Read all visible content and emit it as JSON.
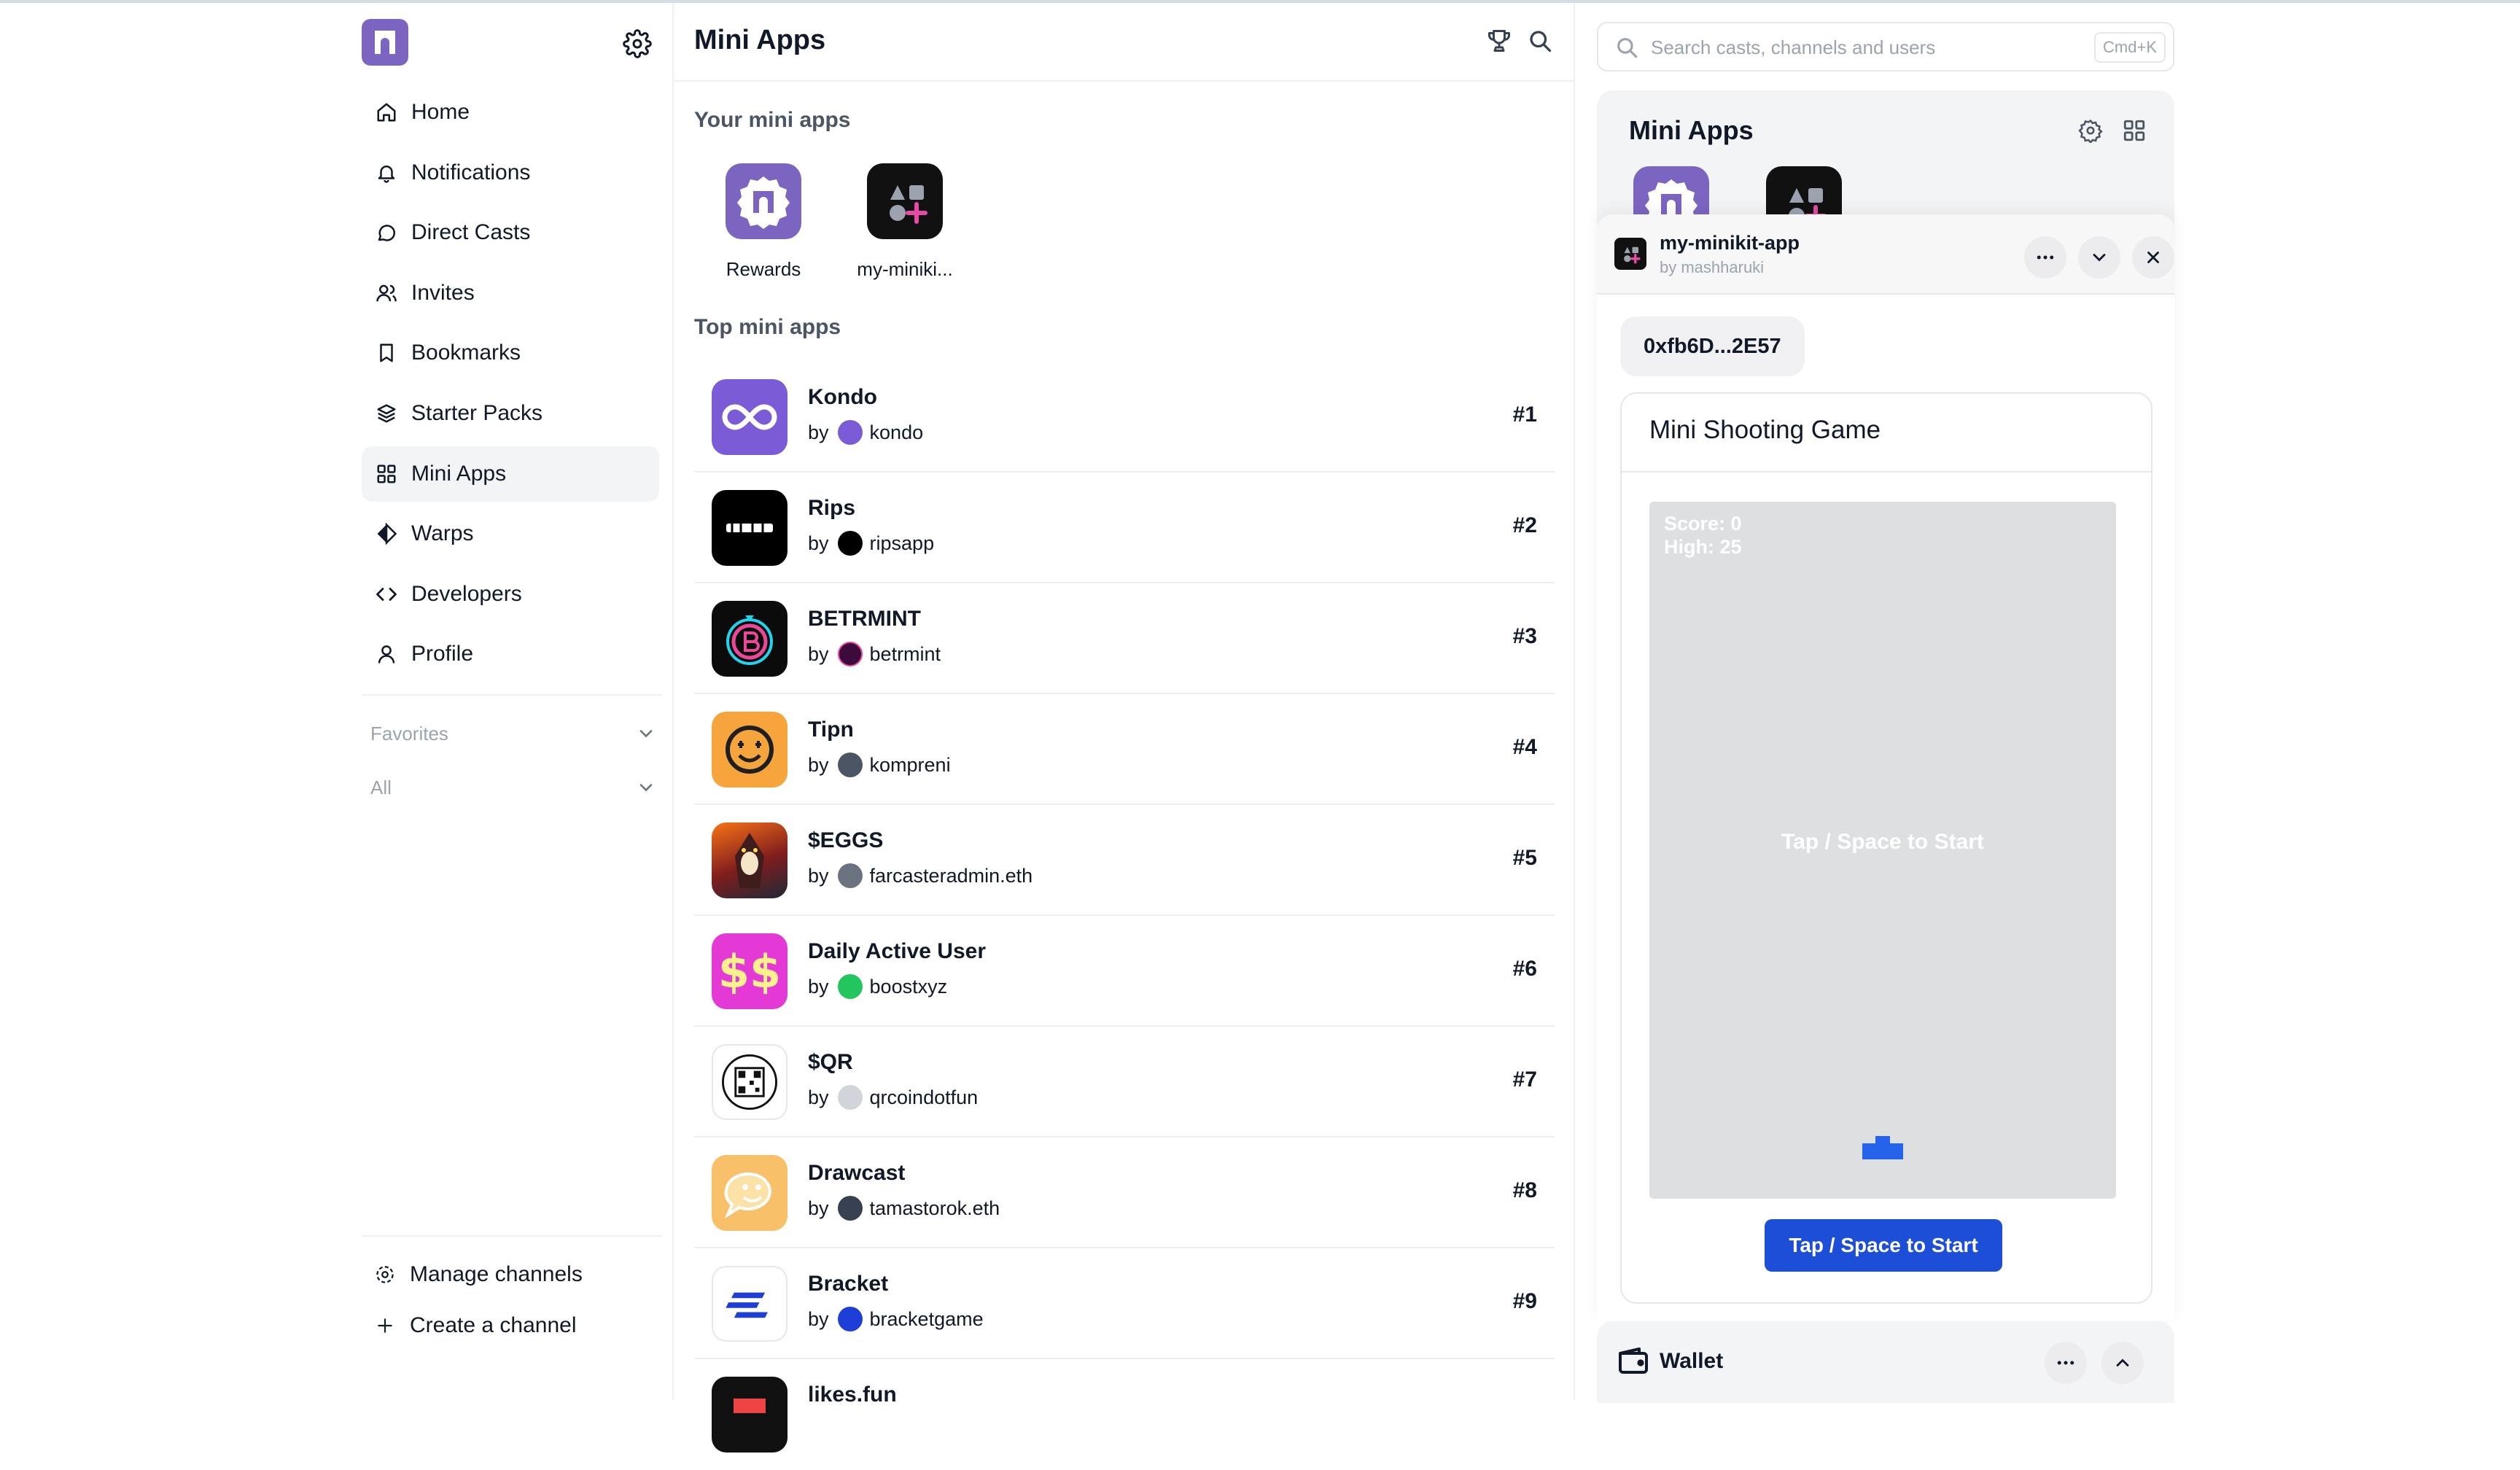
{
  "sidebar": {
    "nav": [
      {
        "label": "Home",
        "icon": "home-icon"
      },
      {
        "label": "Notifications",
        "icon": "bell-icon"
      },
      {
        "label": "Direct Casts",
        "icon": "chat-icon"
      },
      {
        "label": "Invites",
        "icon": "users-icon"
      },
      {
        "label": "Bookmarks",
        "icon": "bookmark-icon"
      },
      {
        "label": "Starter Packs",
        "icon": "box-icon"
      },
      {
        "label": "Mini Apps",
        "icon": "grid-icon",
        "active": true
      },
      {
        "label": "Warps",
        "icon": "diamond-icon"
      },
      {
        "label": "Developers",
        "icon": "code-icon"
      },
      {
        "label": "Profile",
        "icon": "user-icon"
      }
    ],
    "sections": [
      {
        "label": "Favorites"
      },
      {
        "label": "All"
      }
    ],
    "bottom": [
      {
        "label": "Manage channels",
        "icon": "settings-icon"
      },
      {
        "label": "Create a channel",
        "icon": "plus-icon"
      }
    ]
  },
  "center": {
    "title": "Mini Apps",
    "your_title": "Your mini apps",
    "your_apps": [
      {
        "label": "Rewards"
      },
      {
        "label": "my-miniki..."
      }
    ],
    "top_title": "Top mini apps",
    "top_apps": [
      {
        "name": "Kondo",
        "by": "by",
        "author": "kondo",
        "rank": "#1",
        "color": "#7c5cd6"
      },
      {
        "name": "Rips",
        "by": "by",
        "author": "ripsapp",
        "rank": "#2",
        "color": "#000000"
      },
      {
        "name": "BETRMINT",
        "by": "by",
        "author": "betrmint",
        "rank": "#3",
        "color": "#0b0b0b"
      },
      {
        "name": "Tipn",
        "by": "by",
        "author": "kompreni",
        "rank": "#4",
        "color": "#f6a53c"
      },
      {
        "name": "$EGGS",
        "by": "by",
        "author": "farcasteradmin.eth",
        "rank": "#5",
        "color": "#8b1e1e"
      },
      {
        "name": "Daily Active User",
        "by": "by",
        "author": "boostxyz",
        "rank": "#6",
        "color": "#e539d6"
      },
      {
        "name": "$QR",
        "by": "by",
        "author": "qrcoindotfun",
        "rank": "#7",
        "color": "#ffffff"
      },
      {
        "name": "Drawcast",
        "by": "by",
        "author": "tamastorok.eth",
        "rank": "#8",
        "color": "#f7c069"
      },
      {
        "name": "Bracket",
        "by": "by",
        "author": "bracketgame",
        "rank": "#9",
        "color": "#ffffff"
      },
      {
        "name": "likes.fun",
        "by": "",
        "author": "",
        "rank": "",
        "color": "#111111"
      }
    ]
  },
  "right": {
    "search": {
      "placeholder": "Search casts, channels and users",
      "shortcut": "Cmd+K"
    },
    "panel_title": "Mini Apps",
    "frame": {
      "app_name": "my-minikit-app",
      "app_by": "by mashharuki",
      "address": "0xfb6D...2E57",
      "game_title": "Mini Shooting Game",
      "score": "Score: 0",
      "high": "High: 25",
      "canvas_prompt": "Tap / Space to Start",
      "button": "Tap / Space to Start"
    },
    "wallet_title": "Wallet"
  },
  "colors": {
    "brand": "#7c65c1",
    "accent": "#1d4ed8",
    "canvas": "#dedfe1"
  }
}
